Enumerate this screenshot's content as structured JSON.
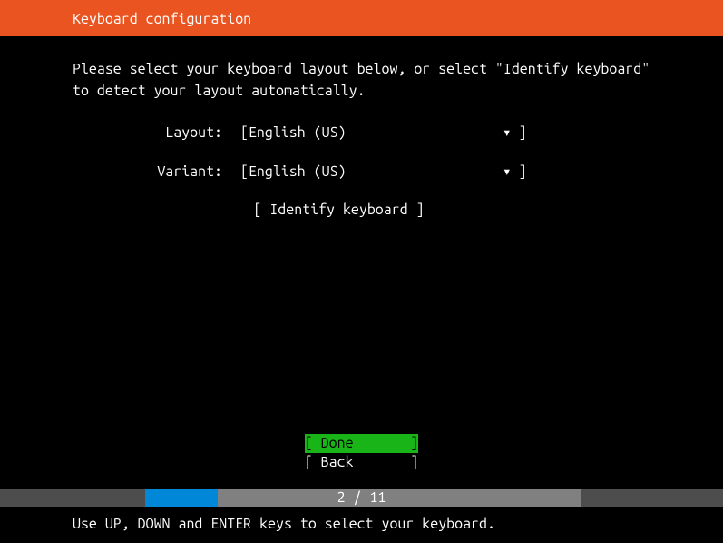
{
  "header": {
    "title": "Keyboard configuration"
  },
  "instructions": "Please select your keyboard layout below, or select \"Identify keyboard\" to detect your layout automatically.",
  "form": {
    "layout": {
      "label": "Layout:",
      "value": "English (US)"
    },
    "variant": {
      "label": "Variant:",
      "value": "English (US)"
    }
  },
  "buttons": {
    "identify": "Identify keyboard",
    "done": "Done",
    "back": "Back"
  },
  "progress": {
    "current": 2,
    "total": 11,
    "text": "2 / 11"
  },
  "footer": {
    "hint": "Use UP, DOWN and ENTER keys to select your keyboard."
  }
}
